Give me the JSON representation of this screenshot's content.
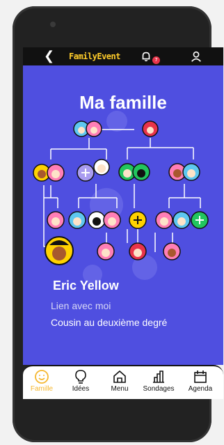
{
  "app": {
    "name": "FamilyEvent",
    "notifications": "7"
  },
  "page": {
    "title": "Ma famille"
  },
  "person": {
    "name": "Eric Yellow",
    "relation_label": "Lien avec moi",
    "relation_value": "Cousin au deuxième degré"
  },
  "nav": {
    "items": [
      {
        "label": "Famille",
        "icon": "smile-icon",
        "active": true
      },
      {
        "label": "Idées",
        "icon": "lightbulb-icon"
      },
      {
        "label": "Menu",
        "icon": "home-icon"
      },
      {
        "label": "Sondages",
        "icon": "bar-chart-icon"
      },
      {
        "label": "Agenda",
        "icon": "calendar-icon"
      }
    ]
  },
  "colors": {
    "background": "#4f4fe0",
    "accent": "#ffcc2a",
    "badge": "#e8344a",
    "add_green": "#22c55e",
    "add_yellow": "#ffd200",
    "add_purple": "#a99cf0"
  }
}
